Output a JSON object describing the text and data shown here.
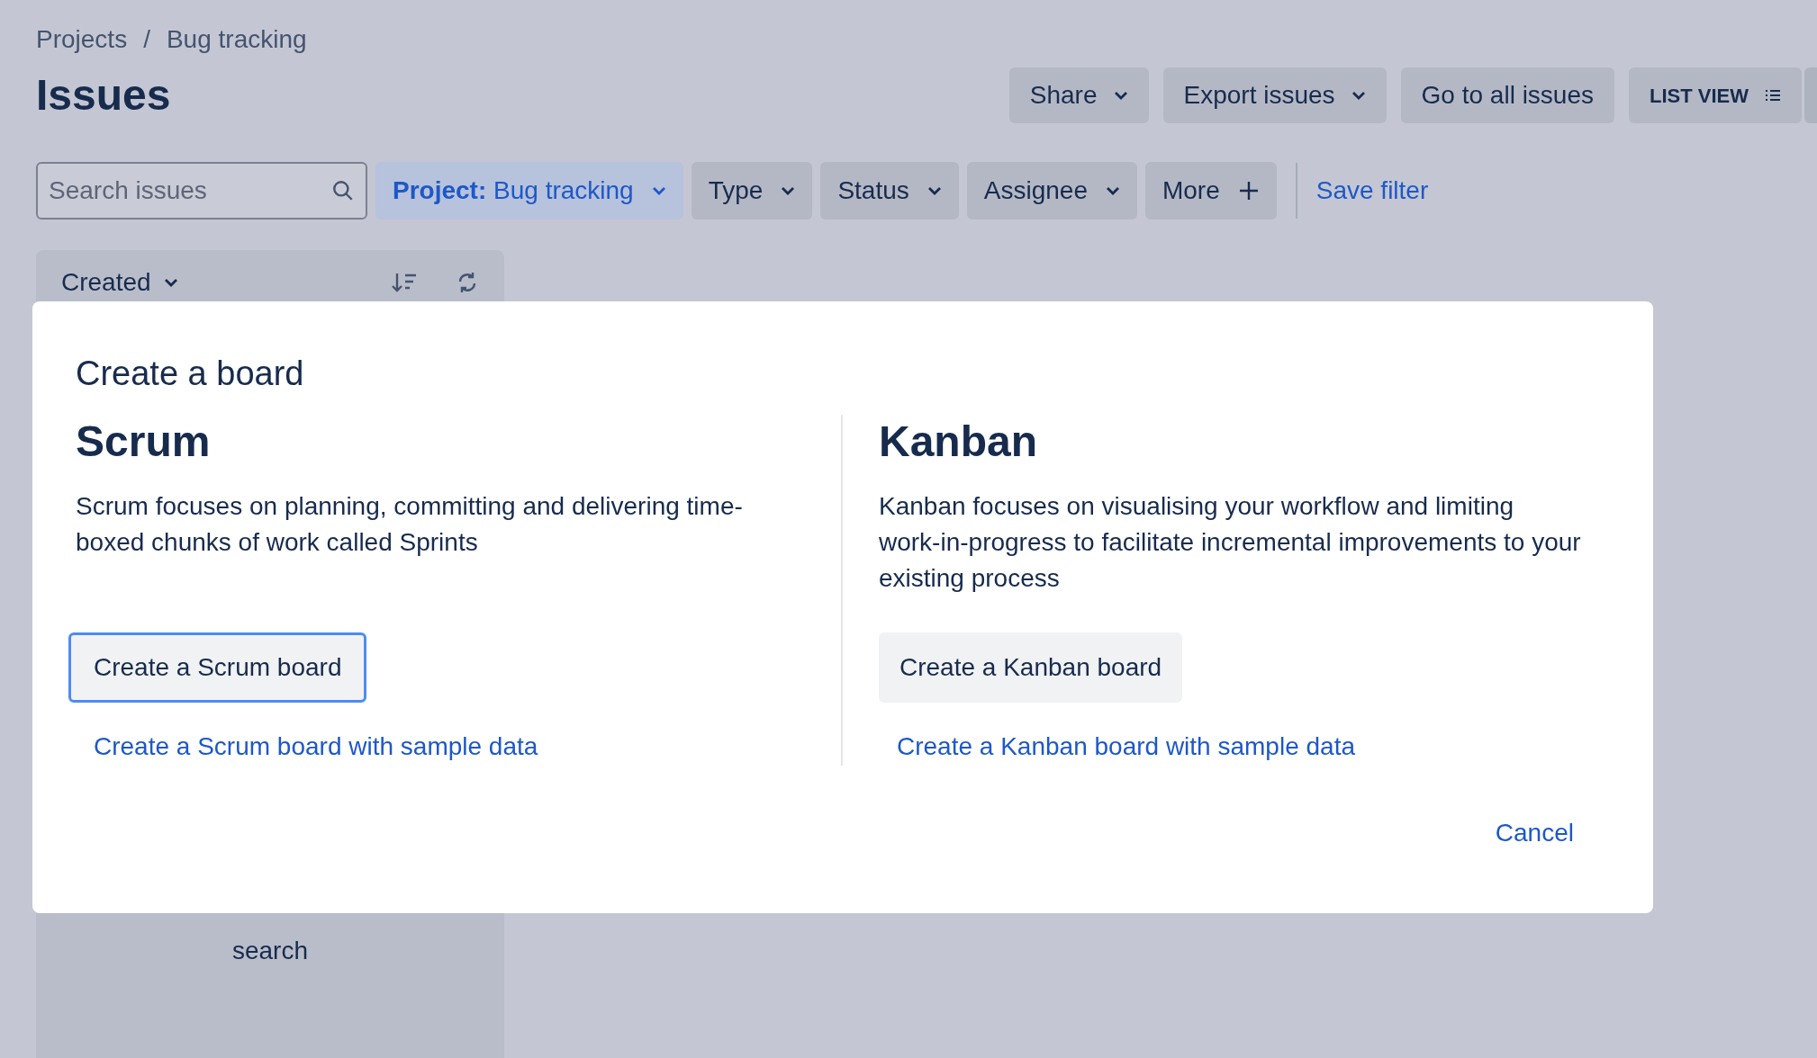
{
  "breadcrumbs": [
    "Projects",
    "Bug tracking"
  ],
  "breadcrumb_separator": "/",
  "title": "Issues",
  "header_buttons": [
    {
      "label": "Share",
      "kind": "dropdown"
    },
    {
      "label": "Export issues",
      "kind": "dropdown"
    },
    {
      "label": "Go to all issues",
      "kind": "plain"
    },
    {
      "label": "LIST VIEW",
      "kind": "list-view"
    }
  ],
  "filters": {
    "search": {
      "placeholder": "Search issues"
    },
    "buttons": [
      {
        "kind": "project",
        "prefix": "Project:",
        "label": "Bug tracking"
      },
      {
        "kind": "dropdown",
        "label": "Type"
      },
      {
        "kind": "dropdown",
        "label": "Status"
      },
      {
        "kind": "dropdown",
        "label": "Assignee"
      },
      {
        "kind": "add",
        "label": "More"
      }
    ],
    "save_filter": "Save filter"
  },
  "panel": {
    "sort_label": "Created",
    "empty_message": "search"
  },
  "modal": {
    "title": "Create a board",
    "columns": [
      {
        "heading": "Scrum",
        "description": "Scrum focuses on planning, committing and delivering time-boxed chunks of work called Sprints",
        "button": {
          "label": "Create a Scrum board",
          "focused": true
        },
        "link": "Create a Scrum board with sample data"
      },
      {
        "heading": "Kanban",
        "description": "Kanban focuses on visualising your workflow and limiting work-in-progress to facilitate incremental improvements to your existing process",
        "button": {
          "label": "Create a Kanban board",
          "focused": false
        },
        "link": "Create a Kanban board with sample data"
      }
    ],
    "cancel": "Cancel"
  }
}
